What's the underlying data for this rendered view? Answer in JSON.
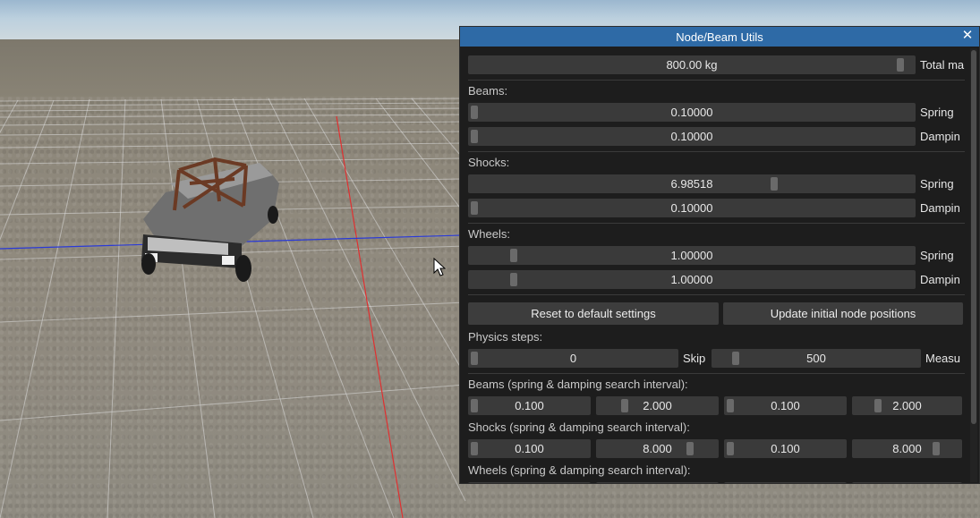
{
  "window": {
    "title": "Node/Beam Utils",
    "close_icon": "✕"
  },
  "total_mass": {
    "value": "800.00 kg",
    "label": "Total ma",
    "level": 0.98
  },
  "beams": {
    "header": "Beams:",
    "spring": {
      "value": "0.10000",
      "label": "Spring",
      "level": 0.0
    },
    "damping": {
      "value": "0.10000",
      "label": "Dampin",
      "level": 0.0
    }
  },
  "shocks": {
    "header": "Shocks:",
    "spring": {
      "value": "6.98518",
      "label": "Spring",
      "level": 0.69
    },
    "damping": {
      "value": "0.10000",
      "label": "Dampin",
      "level": 0.0
    }
  },
  "wheels": {
    "header": "Wheels:",
    "spring": {
      "value": "1.00000",
      "label": "Spring",
      "level": 0.09
    },
    "damping": {
      "value": "1.00000",
      "label": "Dampin",
      "level": 0.09
    }
  },
  "buttons": {
    "reset": "Reset to default settings",
    "update": "Update initial node positions"
  },
  "physics": {
    "header": "Physics steps:",
    "skip": {
      "value": "0",
      "label": "Skip",
      "level": 0.0
    },
    "measure": {
      "value": "500",
      "label": "Measu",
      "level": 0.09
    }
  },
  "beams_interval": {
    "header": "Beams (spring & damping search interval):",
    "values": [
      "0.100",
      "2.000",
      "0.100",
      "2.000"
    ],
    "levels": [
      0.0,
      0.2,
      0.0,
      0.2
    ]
  },
  "shocks_interval": {
    "header": "Shocks (spring & damping search interval):",
    "values": [
      "0.100",
      "8.000",
      "0.100",
      "8.000"
    ],
    "levels": [
      0.0,
      0.8,
      0.0,
      0.8
    ]
  },
  "wheels_interval": {
    "header": "Wheels (spring & damping search interval):"
  },
  "colors": {
    "title_bar": "#2e6aa6",
    "panel_bg": "#1d1d1d",
    "slider_bg": "#3a3a3a",
    "x_axis": "#e03030",
    "y_axis": "#2a3ad8"
  }
}
